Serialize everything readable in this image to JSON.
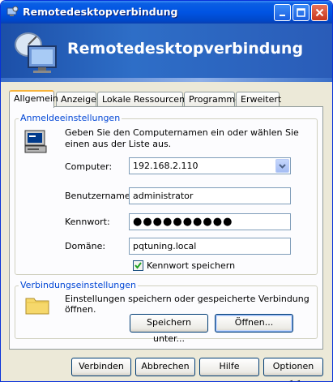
{
  "window": {
    "title": "Remotedesktopverbindung",
    "banner_title": "Remotedesktopverbindung"
  },
  "tabs": [
    {
      "label": "Allgemein",
      "active": true
    },
    {
      "label": "Anzeige",
      "active": false
    },
    {
      "label": "Lokale Ressourcen",
      "active": false
    },
    {
      "label": "Programme",
      "active": false
    },
    {
      "label": "Erweitert",
      "active": false
    }
  ],
  "login": {
    "group_label": "Anmeldeeinstellungen",
    "description": "Geben Sie den Computernamen ein oder wählen Sie einen aus der Liste aus.",
    "computer_label": "Computer:",
    "computer_value": "192.168.2.110",
    "username_label": "Benutzername:",
    "username_value": "administrator",
    "password_label": "Kennwort:",
    "password_value": "●●●●●●●●●●",
    "domain_label": "Domäne:",
    "domain_value": "pqtuning.local",
    "save_password_label": "Kennwort speichern",
    "save_password_checked": true
  },
  "connection": {
    "group_label": "Verbindungseinstellungen",
    "description": "Einstellungen speichern oder gespeicherte Verbindung öffnen.",
    "save_as_label": "Speichern unter...",
    "open_label": "Öffnen..."
  },
  "footer": {
    "connect_label": "Verbinden",
    "cancel_label": "Abbrechen",
    "help_label": "Hilfe",
    "options_label": "Optionen <<"
  },
  "icons": {
    "app": "remote-desktop-icon",
    "computer": "computer-icon",
    "folder": "folder-icon"
  },
  "colors": {
    "titlebar": "#0054e3",
    "group_label": "#0046d5",
    "tab_highlight": "#f8b43c"
  }
}
